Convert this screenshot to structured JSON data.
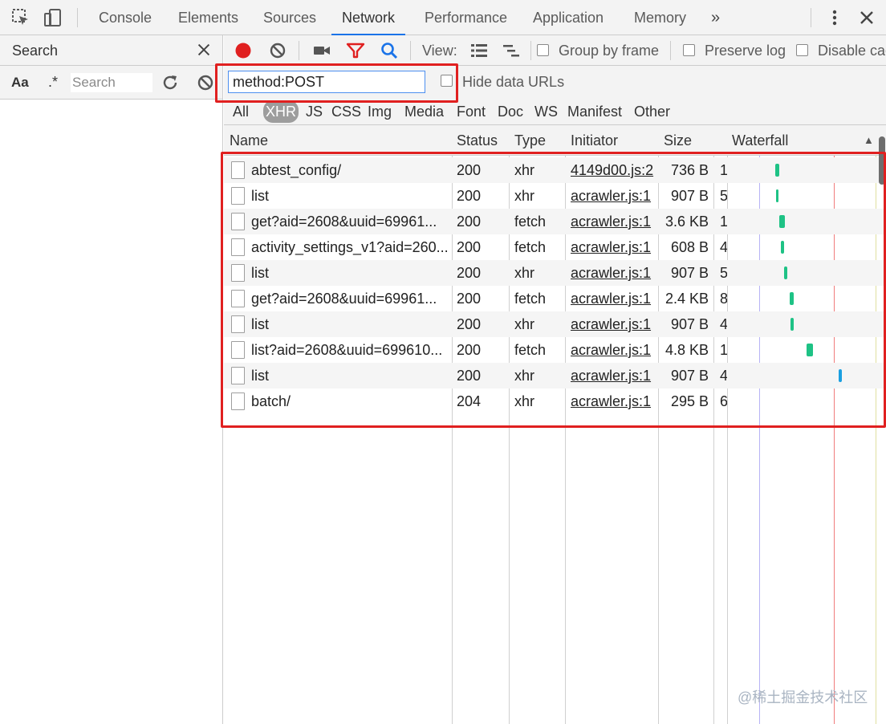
{
  "colors": {
    "accent": "#1a73e8",
    "record": "#e02020",
    "filter_icon": "#e02020",
    "search_icon": "#1a73e8",
    "waterfall_green": "#1ec285",
    "waterfall_blue": "#1a9fe0",
    "highlight_box": "#e02020"
  },
  "topbar": {
    "icons": [
      "inspect-element-icon",
      "device-toolbar-icon"
    ],
    "tabs": [
      {
        "label": "Console",
        "active": false
      },
      {
        "label": "Elements",
        "active": false
      },
      {
        "label": "Sources",
        "active": false
      },
      {
        "label": "Network",
        "active": true
      },
      {
        "label": "Performance",
        "active": false
      },
      {
        "label": "Application",
        "active": false
      },
      {
        "label": "Memory",
        "active": false
      }
    ],
    "more_tabs": "»"
  },
  "sidebar": {
    "title": "Search",
    "case_toggle": "Aa",
    "regex_toggle": ".*",
    "search_placeholder": "Search"
  },
  "network_toolbar": {
    "view_label": "View:",
    "group_by_frame": "Group by frame",
    "preserve_log": "Preserve log",
    "disable_cache": "Disable cac"
  },
  "filter": {
    "value": "method:POST",
    "hide_data_urls": "Hide data URLs",
    "types": [
      {
        "label": "All",
        "active": false
      },
      {
        "label": "XHR",
        "active": true
      },
      {
        "label": "JS",
        "active": false
      },
      {
        "label": "CSS",
        "active": false
      },
      {
        "label": "Img",
        "active": false
      },
      {
        "label": "Media",
        "active": false
      },
      {
        "label": "Font",
        "active": false
      },
      {
        "label": "Doc",
        "active": false
      },
      {
        "label": "WS",
        "active": false
      },
      {
        "label": "Manifest",
        "active": false
      },
      {
        "label": "Other",
        "active": false
      }
    ]
  },
  "table": {
    "columns": {
      "name": "Name",
      "status": "Status",
      "type": "Type",
      "initiator": "Initiator",
      "size": "Size",
      "time": "",
      "waterfall": "Waterfall"
    },
    "sort_indicator": "▲",
    "rows": [
      {
        "name": "abtest_config/",
        "status": "200",
        "type": "xhr",
        "initiator": "4149d00.js:2",
        "size": "736 B",
        "time": "1",
        "wf_start": 0.32,
        "wf_len": 0.03,
        "wf_color": "green"
      },
      {
        "name": "list",
        "status": "200",
        "type": "xhr",
        "initiator": "acrawler.js:1",
        "size": "907 B",
        "time": "5",
        "wf_start": 0.325,
        "wf_len": 0.02,
        "wf_color": "green"
      },
      {
        "name": "get?aid=2608&uuid=69961...",
        "status": "200",
        "type": "fetch",
        "initiator": "acrawler.js:1",
        "size": "3.6 KB",
        "time": "1",
        "wf_start": 0.35,
        "wf_len": 0.035,
        "wf_color": "green"
      },
      {
        "name": "activity_settings_v1?aid=260...",
        "status": "200",
        "type": "fetch",
        "initiator": "acrawler.js:1",
        "size": "608 B",
        "time": "4",
        "wf_start": 0.36,
        "wf_len": 0.02,
        "wf_color": "green"
      },
      {
        "name": "list",
        "status": "200",
        "type": "xhr",
        "initiator": "acrawler.js:1",
        "size": "907 B",
        "time": "5",
        "wf_start": 0.38,
        "wf_len": 0.02,
        "wf_color": "green"
      },
      {
        "name": "get?aid=2608&uuid=69961...",
        "status": "200",
        "type": "fetch",
        "initiator": "acrawler.js:1",
        "size": "2.4 KB",
        "time": "8",
        "wf_start": 0.42,
        "wf_len": 0.025,
        "wf_color": "green"
      },
      {
        "name": "list",
        "status": "200",
        "type": "xhr",
        "initiator": "acrawler.js:1",
        "size": "907 B",
        "time": "4",
        "wf_start": 0.425,
        "wf_len": 0.02,
        "wf_color": "green"
      },
      {
        "name": "list?aid=2608&uuid=699610...",
        "status": "200",
        "type": "fetch",
        "initiator": "acrawler.js:1",
        "size": "4.8 KB",
        "time": "1",
        "wf_start": 0.53,
        "wf_len": 0.045,
        "wf_color": "green"
      },
      {
        "name": "list",
        "status": "200",
        "type": "xhr",
        "initiator": "acrawler.js:1",
        "size": "907 B",
        "time": "4",
        "wf_start": 0.75,
        "wf_len": 0.02,
        "wf_color": "blue"
      },
      {
        "name": "batch/",
        "status": "204",
        "type": "xhr",
        "initiator": "acrawler.js:1",
        "size": "295 B",
        "time": "6",
        "wf_start": 0,
        "wf_len": 0,
        "wf_color": "none"
      }
    ]
  },
  "watermark": "@稀土掘金技术社区"
}
